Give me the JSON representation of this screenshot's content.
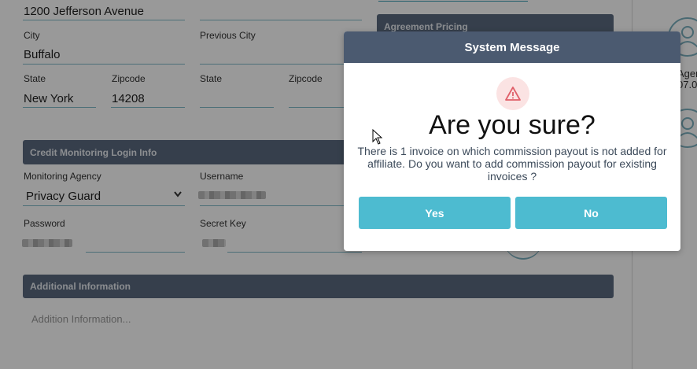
{
  "address": {
    "street_value": "1200 Jefferson Avenue",
    "city_label": "City",
    "city_value": "Buffalo",
    "previous_city_label": "Previous City",
    "state_label": "State",
    "state_value": "New York",
    "zipcode_label": "Zipcode",
    "zipcode_value": "14208",
    "prev_state_label": "State",
    "prev_zipcode_label": "Zipcode"
  },
  "agreement": {
    "title": "Agreement Pricing"
  },
  "credit_monitoring": {
    "title": "Credit Monitoring Login Info",
    "agency_label": "Monitoring Agency",
    "agency_value": "Privacy Guard",
    "username_label": "Username",
    "password_label": "Password",
    "secret_key_label": "Secret Key"
  },
  "additional": {
    "title": "Additional Information",
    "placeholder": "Addition Information..."
  },
  "right_panel": {
    "text_1": "Agen",
    "text_2": "07.0"
  },
  "modal": {
    "header": "System Message",
    "icon": "warning-icon",
    "title": "Are you sure?",
    "message": "There is 1 invoice on which commission payout is not added for affiliate. Do you want to add commission payout for existing invoices ?",
    "yes_label": "Yes",
    "no_label": "No"
  },
  "colors": {
    "header": "#4b5a70",
    "button": "#4dbbd0",
    "section_bar": "#5b6a7f"
  }
}
